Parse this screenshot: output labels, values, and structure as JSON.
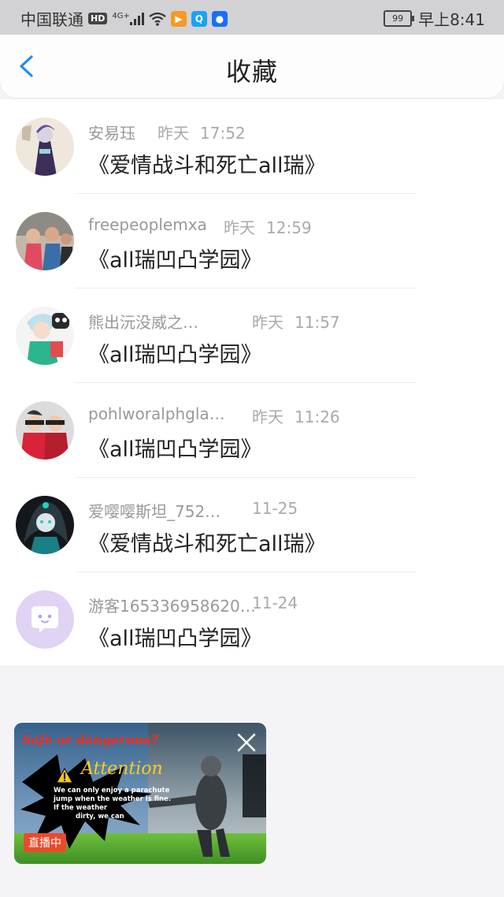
{
  "status_bar": {
    "carrier": "中国联通",
    "hd": "HD",
    "network": "4G+",
    "battery": "99",
    "time": "早上8:41"
  },
  "nav": {
    "title": "收藏"
  },
  "favorites": [
    {
      "user": "安易珏",
      "date": "昨天",
      "time": "17:52",
      "title": "《爱情战斗和死亡all瑞》"
    },
    {
      "user": "freepeoplemxa",
      "date": "昨天",
      "time": "12:59",
      "title": "《all瑞凹凸学园》"
    },
    {
      "user": "熊出沅没威之…",
      "date": "昨天",
      "time": "11:57",
      "title": "《all瑞凹凸学园》"
    },
    {
      "user": "pohlworalphgla…",
      "date": "昨天",
      "time": "11:26",
      "title": "《all瑞凹凸学园》"
    },
    {
      "user": "爱嘤嘤斯坦_752…",
      "date": "",
      "time": "11-25",
      "title": "《爱情战斗和死亡all瑞》"
    },
    {
      "user": "游客165336958620…",
      "date": "",
      "time": "11-24",
      "title": "《all瑞凹凸学园》"
    }
  ],
  "ad": {
    "headline": "Safe or dangerous?",
    "attention": "Attention",
    "line1": "We can only enjoy a parachute",
    "line2": "jump when the weather is fine.",
    "line3": "If the weather",
    "line4": "dirty, we can",
    "live_badge": "直播中"
  },
  "colors": {
    "accent": "#1e8ef5",
    "live": "#ea4a2a"
  }
}
